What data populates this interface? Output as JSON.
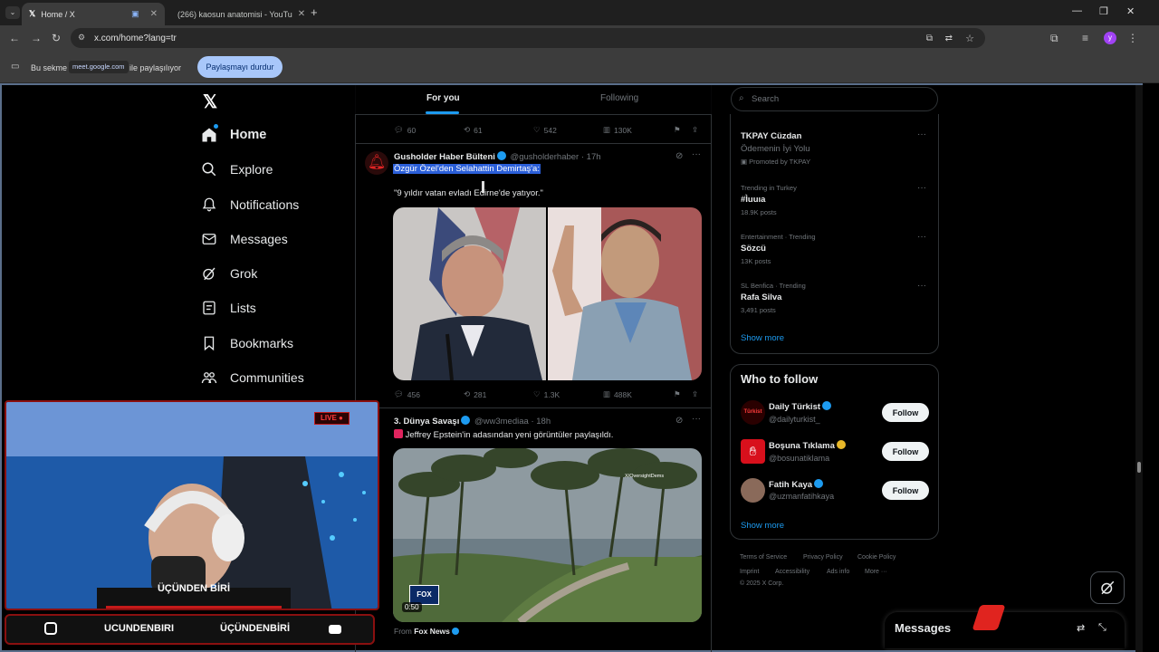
{
  "browser": {
    "tabs": [
      {
        "label": "Home / X",
        "active": true
      },
      {
        "label": "(266) kaosun anatomisi - YouTu",
        "active": false
      }
    ],
    "url": "x.com/home?lang=tr",
    "share_bar": {
      "prefix": "Bu sekme",
      "host_chip": "meet.google.com",
      "suffix": "ile paylaşılıyor",
      "stop_button": "Paylaşmayı durdur"
    }
  },
  "nav": {
    "items": [
      {
        "label": "Home"
      },
      {
        "label": "Explore"
      },
      {
        "label": "Notifications"
      },
      {
        "label": "Messages"
      },
      {
        "label": "Grok"
      },
      {
        "label": "Lists"
      },
      {
        "label": "Bookmarks"
      },
      {
        "label": "Communities"
      }
    ]
  },
  "feed": {
    "tabs": [
      "For you",
      "Following"
    ],
    "top_actions": {
      "replies": "60",
      "reposts": "61",
      "likes": "542",
      "views": "130K"
    },
    "tweet1": {
      "name": "Gusholder Haber Bülteni",
      "handle": "@gusholderhaber",
      "time": "· 17h",
      "line1": "Özgür Özel'den Selahattin Demirtaş'a:",
      "line2": "\"9 yıldır vatan evladı Edirne'de yatıyor.\"",
      "actions": {
        "replies": "456",
        "reposts": "281",
        "likes": "1.3K",
        "views": "488K"
      }
    },
    "tweet2": {
      "name": "3. Dünya Savaşı",
      "handle": "@ww3mediaa",
      "time": "· 18h",
      "text": "Jeffrey Epstein'in adasından yeni görüntüler paylaşıldı.",
      "video_time": "0:50",
      "watermark": "X/OversightDems",
      "from_prefix": "From",
      "from_source": "Fox News"
    }
  },
  "right": {
    "search_placeholder": "Search",
    "trends": [
      {
        "meta": "TKPAY Cüzdan",
        "title": "Ödemenin İyi Yolu",
        "count": "Promoted by TKPAY"
      },
      {
        "meta": "Trending in Turkey",
        "title": "#Ìuuıa",
        "count": "18.9K posts"
      },
      {
        "meta": "Entertainment · Trending",
        "title": "Sözcü",
        "count": "13K posts"
      },
      {
        "meta": "SL Benfica · Trending",
        "title": "Rafa Silva",
        "count": "3,491 posts"
      }
    ],
    "show_more": "Show more",
    "who_to_follow": {
      "title": "Who to follow",
      "users": [
        {
          "name": "Daily Türkist",
          "handle": "@dailyturkist_",
          "button": "Follow"
        },
        {
          "name": "Boşuna Tıklama",
          "handle": "@bosunatiklama",
          "button": "Follow"
        },
        {
          "name": "Fatih Kaya",
          "handle": "@uzmanfatihkaya",
          "button": "Follow"
        }
      ],
      "show_more": "Show more"
    },
    "footer": {
      "links": [
        "Terms of Service",
        "Privacy Policy",
        "Cookie Policy",
        "Imprint",
        "Accessibility",
        "Ads info",
        "More ···"
      ],
      "copyright": "© 2025 X Corp."
    },
    "messages_dock": "Messages"
  },
  "stream": {
    "cam_name": "ÜÇÜNDEN BİRİ",
    "handles": [
      "UCUNDENBIRI",
      "ÜÇÜNDENBİRİ"
    ],
    "live_badge": "LIVE"
  },
  "colors": {
    "accent": "#1d9bf0",
    "highlight": "#2b5fd9",
    "stream_red": "#8a1010"
  }
}
